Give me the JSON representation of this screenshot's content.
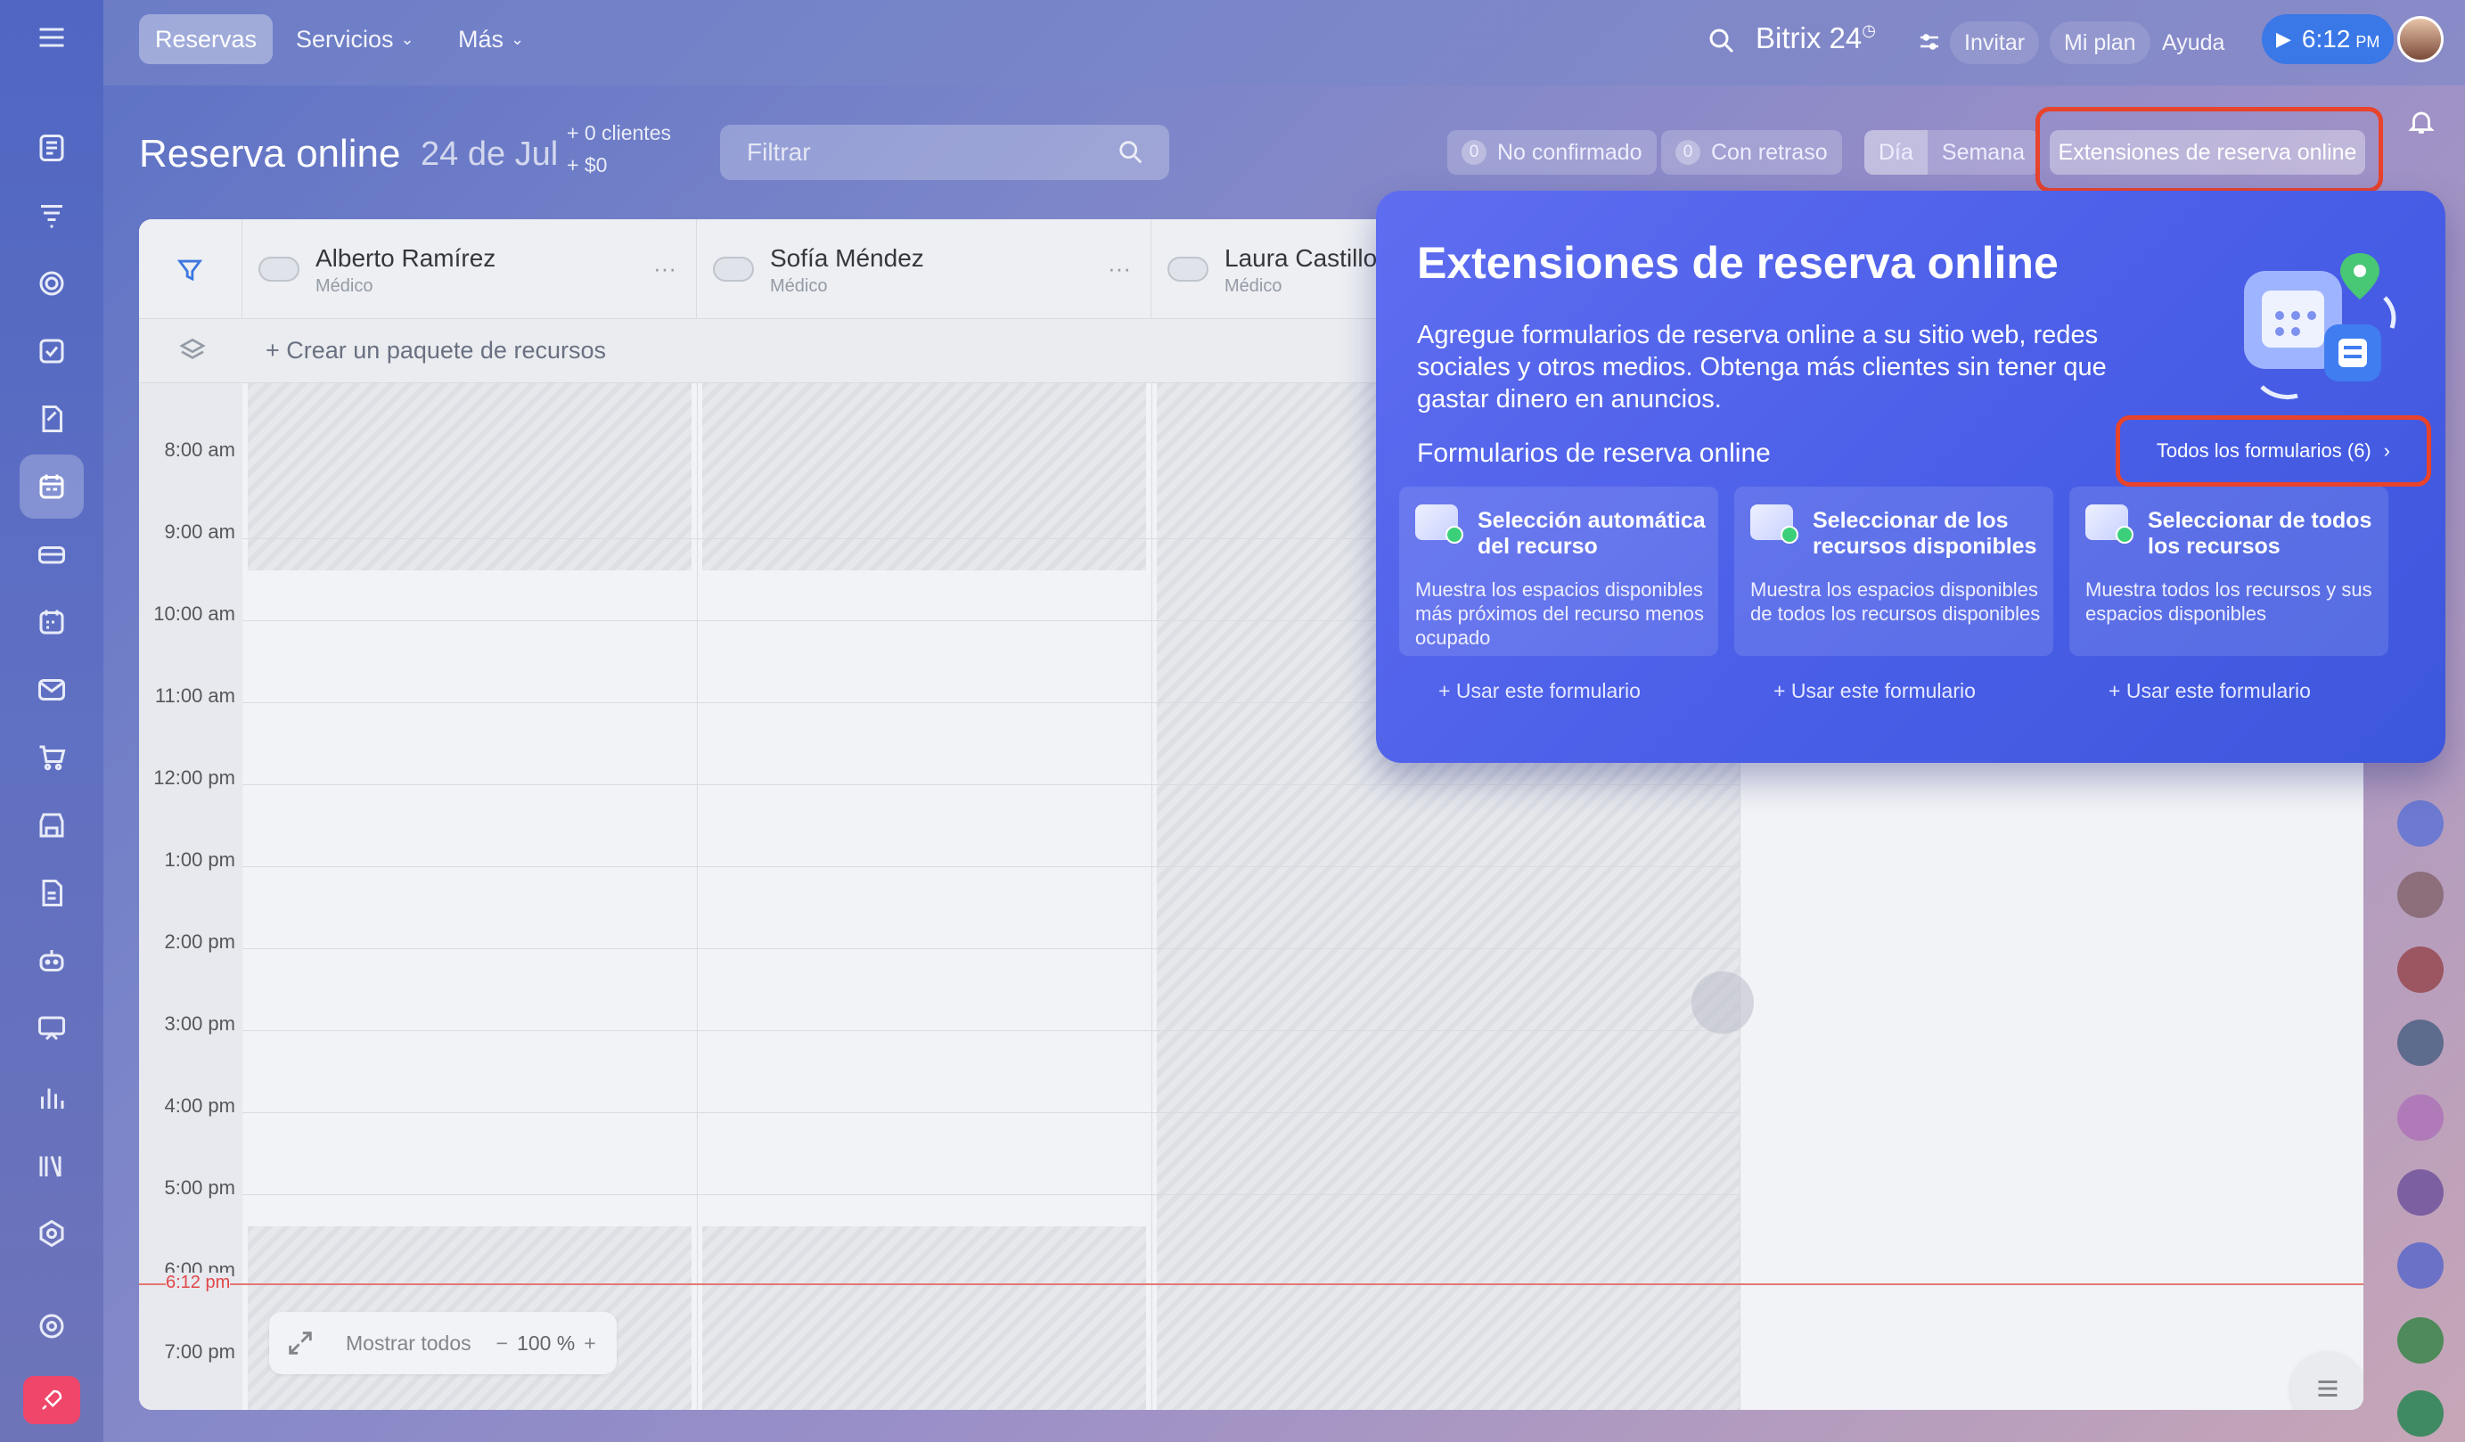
{
  "topbar": {
    "nav": [
      {
        "label": "Reservas",
        "active": true
      },
      {
        "label": "Servicios",
        "active": false
      },
      {
        "label": "Más",
        "active": false
      }
    ],
    "brand": "Bitrix 24",
    "invite": "Invitar",
    "plan": "Mi plan",
    "help": "Ayuda",
    "time": "6:12",
    "time_suffix": "PM"
  },
  "header": {
    "title": "Reserva online",
    "date": "24 de Jul",
    "clients": "+ 0 clientes",
    "revenue": "+ $0",
    "filter_placeholder": "Filtrar",
    "unconfirmed_count": "0",
    "unconfirmed_label": "No confirmado",
    "delayed_count": "0",
    "delayed_label": "Con retraso",
    "view_day": "Día",
    "view_week": "Semana",
    "extensions_button": "Extensiones de reserva online"
  },
  "resources": [
    {
      "name": "Alberto Ramírez",
      "role": "Médico"
    },
    {
      "name": "Sofía Méndez",
      "role": "Médico"
    },
    {
      "name": "Laura Castillo",
      "role": "Médico"
    }
  ],
  "create_package": "+ Crear un paquete de recursos",
  "times": [
    "8:00 am",
    "9:00 am",
    "10:00 am",
    "11:00 am",
    "12:00 pm",
    "1:00 pm",
    "2:00 pm",
    "3:00 pm",
    "4:00 pm",
    "5:00 pm",
    "6:00 pm",
    "7:00 pm"
  ],
  "now_label": "6:12 pm",
  "zoom": {
    "show_all": "Mostrar todos",
    "level": "100 %"
  },
  "popup": {
    "title": "Extensiones de reserva online",
    "description": "Agregue formularios de reserva online a su sitio web, redes sociales y otros medios. Obtenga más clientes sin tener que gastar dinero en anuncios.",
    "subtitle": "Formularios de reserva online",
    "all_forms": "Todos los formularios (6)",
    "cards": [
      {
        "title": "Selección automática del recurso",
        "desc": "Muestra los espacios disponibles más próximos del recurso menos ocupado",
        "action": "Usar este formulario"
      },
      {
        "title": "Seleccionar de los recursos disponibles",
        "desc": "Muestra los espacios disponibles de todos los recursos disponibles",
        "action": "Usar este formulario"
      },
      {
        "title": "Seleccionar de todos los recursos",
        "desc": "Muestra todos los recursos y sus espacios disponibles",
        "action": "Usar este formulario"
      }
    ]
  },
  "colors": {
    "accent": "#3a78e8",
    "popup": "#4b5fe8",
    "highlight": "#e8432b",
    "now": "#f07a70"
  }
}
